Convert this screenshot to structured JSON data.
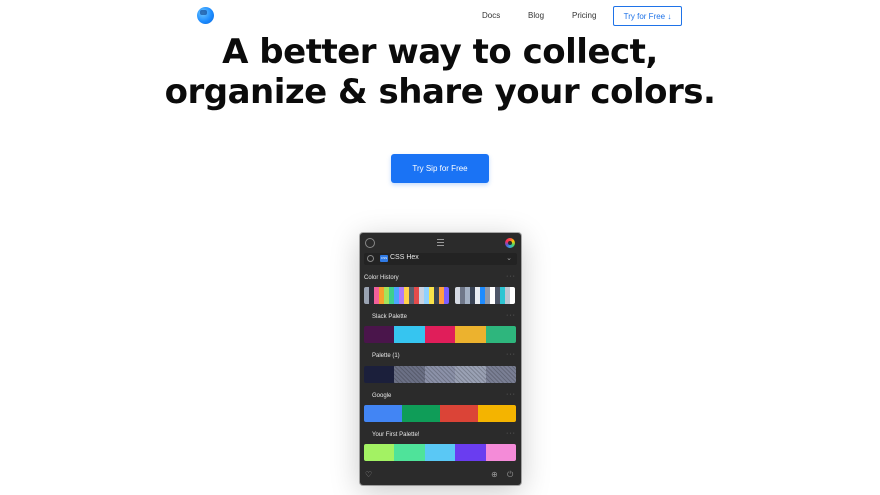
{
  "nav": {
    "links": [
      "Docs",
      "Blog",
      "Pricing"
    ],
    "cta_label": "Try for Free ↓"
  },
  "hero": {
    "line1": "A better way to collect,",
    "line2": "organize & share your colors.",
    "cta_label": "Try Sip for Free"
  },
  "app": {
    "format": {
      "badge": "CSS",
      "label": "CSS Hex"
    },
    "history": {
      "title": "Color History",
      "group1": [
        "#9aa3b2",
        "#2c2c3a",
        "#f25f9a",
        "#f7a02c",
        "#a5e35a",
        "#3ecf8e",
        "#4ca6ff",
        "#b07cf7",
        "#ffd24a",
        "#5a6272",
        "#e54b4b",
        "#c9d2e0",
        "#8fd1ff",
        "#f9e24a",
        "#3a4352",
        "#ff9e40",
        "#7a5cff"
      ],
      "group2": [
        "#d5dae3",
        "#6f7789",
        "#a4b1c4",
        "#3a4456",
        "#e9edf3",
        "#1e8cff",
        "#9099aa",
        "#ffffff",
        "#4e5668",
        "#2ec5d3",
        "#bfc6d2",
        "#ffffff"
      ]
    },
    "palettes": [
      {
        "title": "Slack Palette",
        "colors": [
          "#4a154b",
          "#36c5f0",
          "#e01e5a",
          "#ecb22e",
          "#2eb67d"
        ]
      },
      {
        "title": "Palette (1)",
        "colors": [
          "#1b1f3b",
          "#6b7085",
          "#8b91a8",
          "#9aa1b4",
          "#7a7f94"
        ]
      },
      {
        "title": "Google",
        "colors": [
          "#4285f4",
          "#0f9d58",
          "#db4437",
          "#f4b400"
        ]
      },
      {
        "title": "Your First Palette!",
        "colors": [
          "#a3f263",
          "#4fe39a",
          "#5ac8f5",
          "#6a3df0",
          "#f48bd8"
        ]
      }
    ]
  }
}
